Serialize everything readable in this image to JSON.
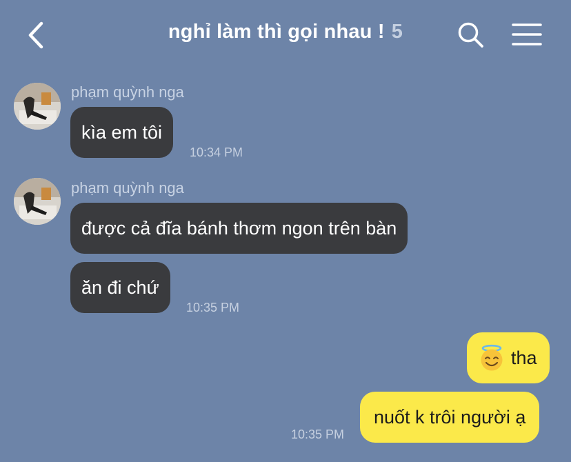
{
  "header": {
    "title": "nghỉ làm thì gọi nhau !",
    "member_count": "5",
    "back_icon": "chevron-left-icon",
    "search_icon": "search-icon",
    "menu_icon": "hamburger-menu-icon"
  },
  "messages": [
    {
      "sender": "phạm quỳnh nga",
      "text": "kìa em tôi",
      "time": "10:34 PM",
      "direction": "incoming"
    },
    {
      "sender": "phạm quỳnh nga",
      "text": "được cả đĩa bánh thơm ngon trên bàn",
      "direction": "incoming"
    },
    {
      "text": "ăn đi chứ",
      "time": "10:35 PM",
      "direction": "incoming"
    },
    {
      "emoji": "smiling-face-with-halo",
      "text": "tha",
      "direction": "outgoing"
    },
    {
      "text": "nuốt k trôi người ạ",
      "time": "10:35 PM",
      "direction": "outgoing"
    }
  ],
  "colors": {
    "background": "#6d84a8",
    "incoming_bubble": "#3a3b3e",
    "outgoing_bubble": "#fbe94a"
  }
}
